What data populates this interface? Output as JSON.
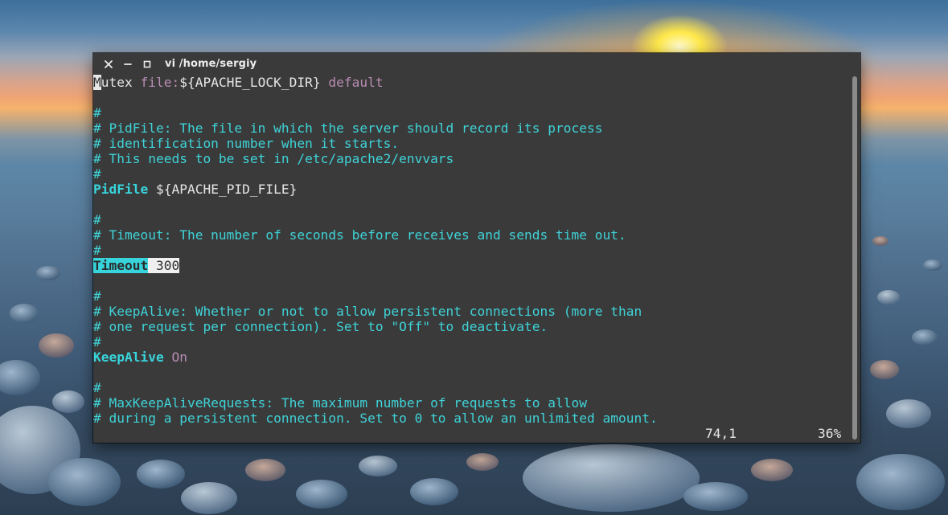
{
  "window": {
    "title": "vi /home/sergiy",
    "controls": {
      "close_icon": "close-icon",
      "minimize_icon": "minimize-icon",
      "maximize_icon": "maximize-icon"
    }
  },
  "editor": {
    "cursor_char": "M",
    "lines": {
      "l1_rest": "utex ",
      "l1_file": "file:",
      "l1_var": "${APACHE_LOCK_DIR} ",
      "l1_default": "default",
      "l3": "#",
      "l4": "# PidFile: The file in which the server should record its process",
      "l5": "# identification number when it starts.",
      "l6": "# This needs to be set in /etc/apache2/envvars",
      "l7": "#",
      "l8_key": "PidFile",
      "l8_val": " ${APACHE_PID_FILE}",
      "l10": "#",
      "l11": "# Timeout: The number of seconds before receives and sends time out.",
      "l12": "#",
      "l13_key": "Timeout",
      "l13_val": " 300",
      "l15": "#",
      "l16": "# KeepAlive: Whether or not to allow persistent connections (more than",
      "l17": "# one request per connection). Set to \"Off\" to deactivate.",
      "l18": "#",
      "l19_key": "KeepAlive",
      "l19_val": "On",
      "l21": "#",
      "l22": "# MaxKeepAliveRequests: The maximum number of requests to allow",
      "l23": "# during a persistent connection. Set to 0 to allow an unlimited amount."
    },
    "status": {
      "position": "74,1",
      "percent": "36%"
    }
  },
  "colors": {
    "comment": "#3fd3d8",
    "keyword": "#38d4dc",
    "string_purple": "#b98db4",
    "background": "#3a3a3a"
  }
}
